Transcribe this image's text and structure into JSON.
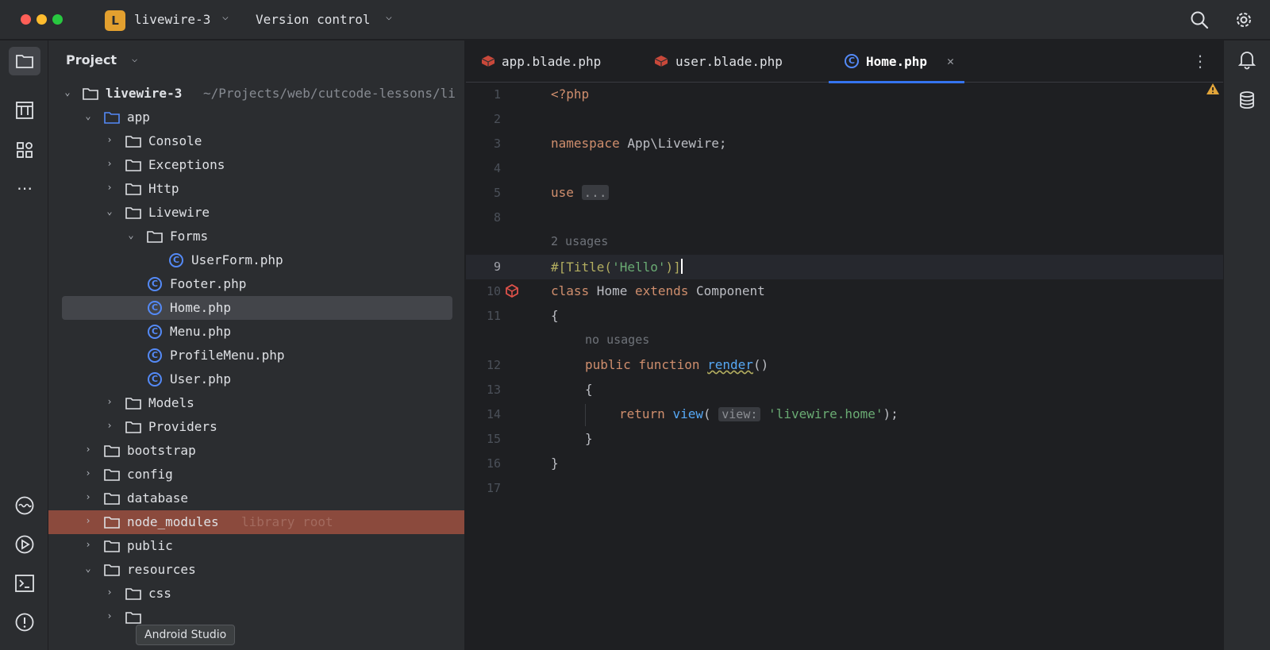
{
  "titlebar": {
    "project_badge": "L",
    "project_name": "livewire-3",
    "vcs_label": "Version control"
  },
  "project_panel": {
    "title": "Project",
    "tree": [
      {
        "label": "livewire-3",
        "path": "~/Projects/web/cutcode-lessons/li",
        "expanded": true,
        "kind": "folder"
      },
      {
        "label": "app",
        "expanded": true,
        "kind": "folder"
      },
      {
        "label": "Console",
        "expanded": false,
        "kind": "folder"
      },
      {
        "label": "Exceptions",
        "expanded": false,
        "kind": "folder"
      },
      {
        "label": "Http",
        "expanded": false,
        "kind": "folder"
      },
      {
        "label": "Livewire",
        "expanded": true,
        "kind": "folder"
      },
      {
        "label": "Forms",
        "expanded": true,
        "kind": "folder"
      },
      {
        "label": "UserForm.php",
        "kind": "class"
      },
      {
        "label": "Footer.php",
        "kind": "class"
      },
      {
        "label": "Home.php",
        "kind": "class",
        "selected": true
      },
      {
        "label": "Menu.php",
        "kind": "class"
      },
      {
        "label": "ProfileMenu.php",
        "kind": "class"
      },
      {
        "label": "User.php",
        "kind": "class"
      },
      {
        "label": "Models",
        "expanded": false,
        "kind": "folder"
      },
      {
        "label": "Providers",
        "expanded": false,
        "kind": "folder"
      },
      {
        "label": "bootstrap",
        "expanded": false,
        "kind": "folder"
      },
      {
        "label": "config",
        "expanded": false,
        "kind": "folder"
      },
      {
        "label": "database",
        "expanded": false,
        "kind": "folder"
      },
      {
        "label": "node_modules",
        "suffix": "library root",
        "expanded": false,
        "kind": "folder"
      },
      {
        "label": "public",
        "expanded": false,
        "kind": "folder"
      },
      {
        "label": "resources",
        "expanded": true,
        "kind": "folder"
      },
      {
        "label": "css",
        "expanded": false,
        "kind": "folder"
      }
    ]
  },
  "tooltip": "Android Studio",
  "tabs": [
    {
      "label": "app.blade.php",
      "icon": "laravel-icon"
    },
    {
      "label": "user.blade.php",
      "icon": "laravel-icon"
    },
    {
      "label": "Home.php",
      "icon": "class-icon",
      "active": true
    }
  ],
  "editor": {
    "line_numbers": [
      "1",
      "2",
      "3",
      "4",
      "5",
      "8",
      "9",
      "10",
      "11",
      "12",
      "13",
      "14",
      "15",
      "16",
      "17"
    ],
    "hints": {
      "usages_2": "2 usages",
      "no_usages": "no usages"
    },
    "code": {
      "l1": "<?php",
      "l3_kw": "namespace",
      "l3_rest": " App\\Livewire;",
      "l5_kw": "use",
      "l5_fold": "...",
      "l9_a": "#[",
      "l9_b": "Title(",
      "l9_c": "'Hello'",
      "l9_d": ")]",
      "l10_kw1": "class",
      "l10_name": " Home ",
      "l10_kw2": "extends",
      "l10_rest": " Component",
      "l11": "{",
      "l12_kw": "public function",
      "l12_fn": "render",
      "l12_rest": "()",
      "l13": "{",
      "l14_kw": "return",
      "l14_fn": "view",
      "l14_p": "(",
      "l14_inlay": "view:",
      "l14_str": "'livewire.home'",
      "l14_end": ");",
      "l15": "}",
      "l16": "}"
    }
  }
}
